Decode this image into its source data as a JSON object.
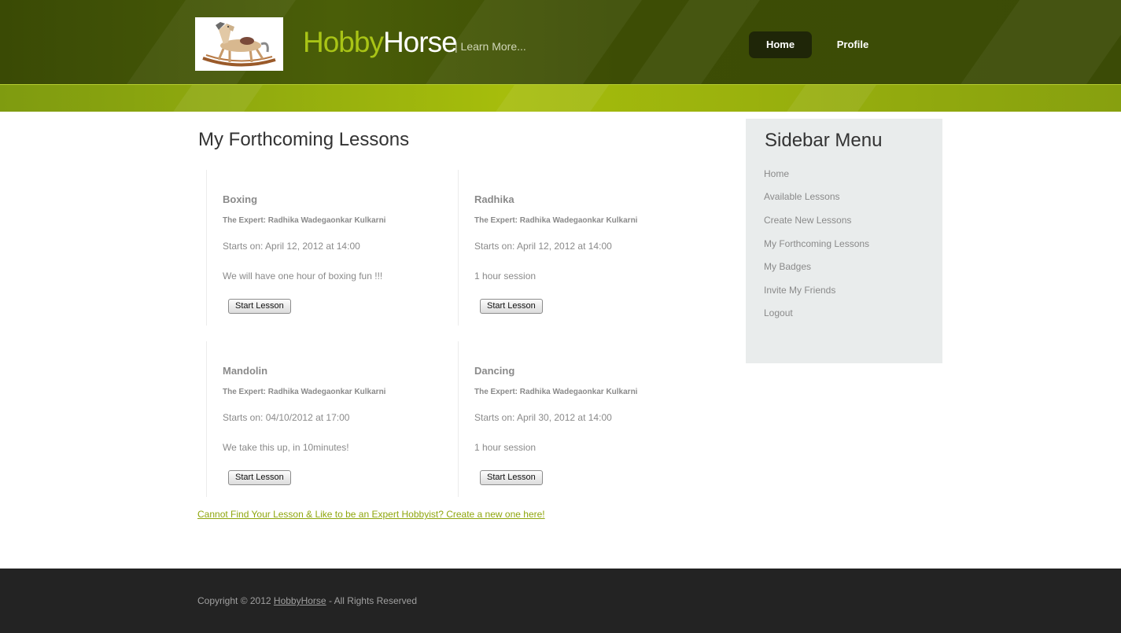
{
  "header": {
    "logo_alt": "rocking horse logo",
    "brand_part1": "Hobby",
    "brand_part2": "Horse",
    "tagline": "| Learn More...",
    "nav": {
      "home": "Home",
      "profile": "Profile"
    },
    "colors": {
      "accent": "#a9c416",
      "header_bg": "#3f4f06",
      "stripe": "#9bb20d"
    }
  },
  "main": {
    "title": "My Forthcoming Lessons",
    "lessons": [
      {
        "name": "Boxing",
        "expert": "The Expert: Radhika Wadegaonkar Kulkarni",
        "starts": "Starts on: April 12, 2012 at 14:00",
        "description": "We will have one hour of boxing fun !!!",
        "button": "Start Lesson"
      },
      {
        "name": "Radhika",
        "expert": "The Expert: Radhika Wadegaonkar Kulkarni",
        "starts": "Starts on: April 12, 2012 at 14:00",
        "description": "1 hour session",
        "button": "Start Lesson"
      },
      {
        "name": "Mandolin",
        "expert": "The Expert: Radhika Wadegaonkar Kulkarni",
        "starts": "Starts on: 04/10/2012 at 17:00",
        "description": "We take this up, in 10minutes!",
        "button": "Start Lesson"
      },
      {
        "name": "Dancing",
        "expert": "The Expert: Radhika Wadegaonkar Kulkarni",
        "starts": "Starts on: April 30, 2012 at 14:00",
        "description": "1 hour session",
        "button": "Start Lesson"
      }
    ],
    "create_link": "Cannot Find Your Lesson & Like to be an Expert Hobbyist? Create a new one here!"
  },
  "sidebar": {
    "title": "Sidebar Menu",
    "items": [
      "Home",
      "Available Lessons",
      "Create New Lessons",
      "My Forthcoming Lessons",
      "My Badges",
      "Invite My Friends",
      "Logout"
    ]
  },
  "footer": {
    "copy_prefix": "Copyright © 2012 ",
    "copy_link": "HobbyHorse",
    "copy_suffix": " - All Rights Reserved"
  }
}
